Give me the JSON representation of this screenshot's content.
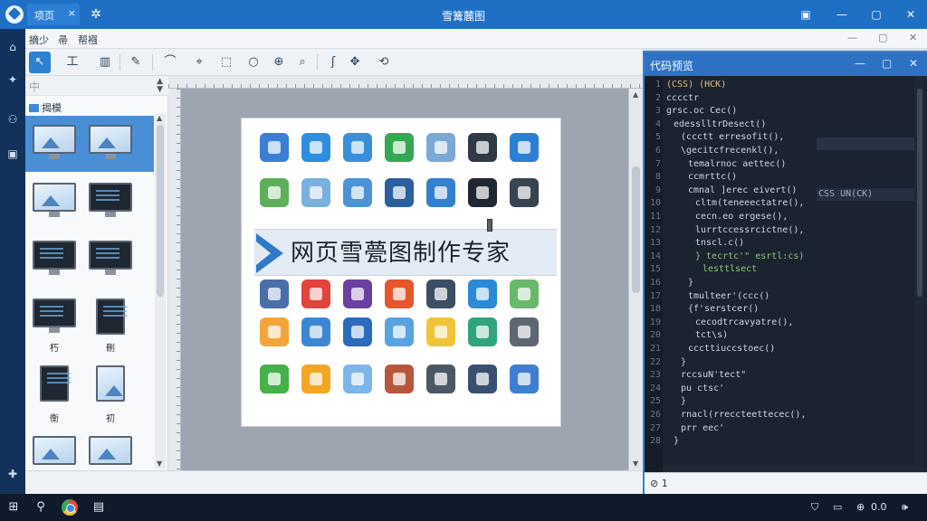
{
  "window": {
    "title": "雪篝麓图",
    "tab_label": "项页",
    "tab_close": "×",
    "settings_glyph": "✲",
    "controls": {
      "save": "▣",
      "minimize": "—",
      "maximize": "▢",
      "close": "✕"
    }
  },
  "menubar": {
    "items": [
      "摘少",
      "帚",
      "帮襁"
    ],
    "sub_controls": {
      "minimize": "—",
      "maximize": "▢",
      "close": "✕"
    }
  },
  "toolbar": {
    "tools": [
      {
        "name": "select",
        "glyph": "↖",
        "active": true
      },
      {
        "name": "text",
        "glyph": "工"
      },
      {
        "name": "layout",
        "glyph": "▥"
      },
      {
        "name": "pen",
        "glyph": "✎"
      },
      {
        "name": "curve",
        "glyph": "⌒"
      },
      {
        "name": "node",
        "glyph": "⌖"
      },
      {
        "name": "crop",
        "glyph": "⬚"
      },
      {
        "name": "lasso",
        "glyph": "○"
      },
      {
        "name": "zoom-in",
        "glyph": "⊕"
      },
      {
        "name": "zoom",
        "glyph": "⌕"
      },
      {
        "name": "hook",
        "glyph": "ʃ"
      },
      {
        "name": "move",
        "glyph": "✥"
      },
      {
        "name": "transform",
        "glyph": "⟲"
      }
    ]
  },
  "left_panel": {
    "head_icon": "中",
    "category_label": "揭模",
    "captions": [
      "朽",
      "刪",
      "衡",
      "初"
    ]
  },
  "canvas": {
    "banner_text": "网页雪甍图制作专家",
    "icon_colors": [
      [
        "#3b7fd4",
        "#2f8ee0",
        "#3a8fd8",
        "#34a853",
        "#7aa9d6",
        "#2f3a46",
        "#2d7fd3"
      ],
      [
        "#5fae5a",
        "#7ab0de",
        "#4b93d4",
        "#2c5f9e",
        "#3480d0",
        "#1f2733",
        "#394451"
      ],
      [
        "#4a6fa8",
        "#e2433b",
        "#6c3fa3",
        "#e6562c",
        "#3d4e63",
        "#2b8ad6",
        "#69b96d"
      ],
      [
        "#f2a53a",
        "#3c87d4",
        "#2c6bbd",
        "#5aa2e0",
        "#f0c438",
        "#2fa47d",
        "#5d6672"
      ],
      [
        "#47b04b",
        "#f3a623",
        "#7db6e8",
        "#b8563d",
        "#4a5866",
        "#3b4f70",
        "#3e7fd1"
      ]
    ]
  },
  "code_panel": {
    "title": "代码预览",
    "controls": {
      "minimize": "—",
      "maximize": "▢",
      "close": "✕"
    },
    "inline_hint": "CSS  UN(CK)",
    "status": "⊘ 1",
    "lines": [
      {
        "text": "(CSS) (HCK)",
        "indent": 0,
        "color": "#e4c07a"
      },
      {
        "text": "cccctr",
        "indent": 0,
        "color": "#cdd6e2"
      },
      {
        "text": "grsc.oc Cec()",
        "indent": 0,
        "color": "#cdd6e2"
      },
      {
        "text": "edesslltrDesect()",
        "indent": 1,
        "color": "#cdd6e2"
      },
      {
        "text": "(ccctt erresofit(),",
        "indent": 2,
        "color": "#cdd6e2"
      },
      {
        "text": "\\gecitcfrecenkl(),",
        "indent": 2,
        "color": "#cdd6e2"
      },
      {
        "text": "temalrnoc aettec()",
        "indent": 3,
        "color": "#cdd6e2"
      },
      {
        "text": "ccmrttc()",
        "indent": 3,
        "color": "#cdd6e2"
      },
      {
        "text": "cmnal ]erec eivert()",
        "indent": 3,
        "color": "#cdd6e2"
      },
      {
        "text": "cltm(teneeectatre(),",
        "indent": 4,
        "color": "#cdd6e2"
      },
      {
        "text": "cecn.eo ergese(),",
        "indent": 4,
        "color": "#cdd6e2"
      },
      {
        "text": "lurrtccessrcictne(),",
        "indent": 4,
        "color": "#cdd6e2"
      },
      {
        "text": "tnscl.c()",
        "indent": 4,
        "color": "#cdd6e2"
      },
      {
        "text": "}  tecrtc'\" esrtl:cs)",
        "indent": 4,
        "color": "#8fc57a"
      },
      {
        "text": "lesttlsect",
        "indent": 5,
        "color": "#8fc57a"
      },
      {
        "text": "}",
        "indent": 3,
        "color": "#cdd6e2"
      },
      {
        "text": "tmulteer'(ccc()",
        "indent": 3,
        "color": "#cdd6e2"
      },
      {
        "text": "{f'serstcer()",
        "indent": 3,
        "color": "#cdd6e2"
      },
      {
        "text": "cecodtrcavyatre(),",
        "indent": 4,
        "color": "#cdd6e2"
      },
      {
        "text": "tct\\s)",
        "indent": 4,
        "color": "#cdd6e2"
      },
      {
        "text": "cccttiuccstoec()",
        "indent": 3,
        "color": "#cdd6e2"
      },
      {
        "text": "}",
        "indent": 2,
        "color": "#cdd6e2"
      },
      {
        "text": "rccsuN'tect\"",
        "indent": 2,
        "color": "#cdd6e2"
      },
      {
        "text": "pu ctsc'",
        "indent": 2,
        "color": "#cdd6e2"
      },
      {
        "text": "}",
        "indent": 2,
        "color": "#cdd6e2"
      },
      {
        "text": "rnacl(rreccteettecec(),",
        "indent": 2,
        "color": "#cdd6e2"
      },
      {
        "text": "prr eec'",
        "indent": 2,
        "color": "#cdd6e2"
      },
      {
        "text": "}",
        "indent": 1,
        "color": "#cdd6e2"
      }
    ]
  },
  "leftbar": {
    "glyphs": [
      "⌂",
      "✦",
      "⚇",
      "▣",
      "✚"
    ]
  },
  "taskbar": {
    "start_glyph": "⊞",
    "search_glyph": "⚲",
    "files_glyph": "▤",
    "tray": {
      "shield": "⛉",
      "battery": "▭",
      "net": "⊕",
      "volume": "0.0",
      "speaker": "🕪"
    }
  }
}
